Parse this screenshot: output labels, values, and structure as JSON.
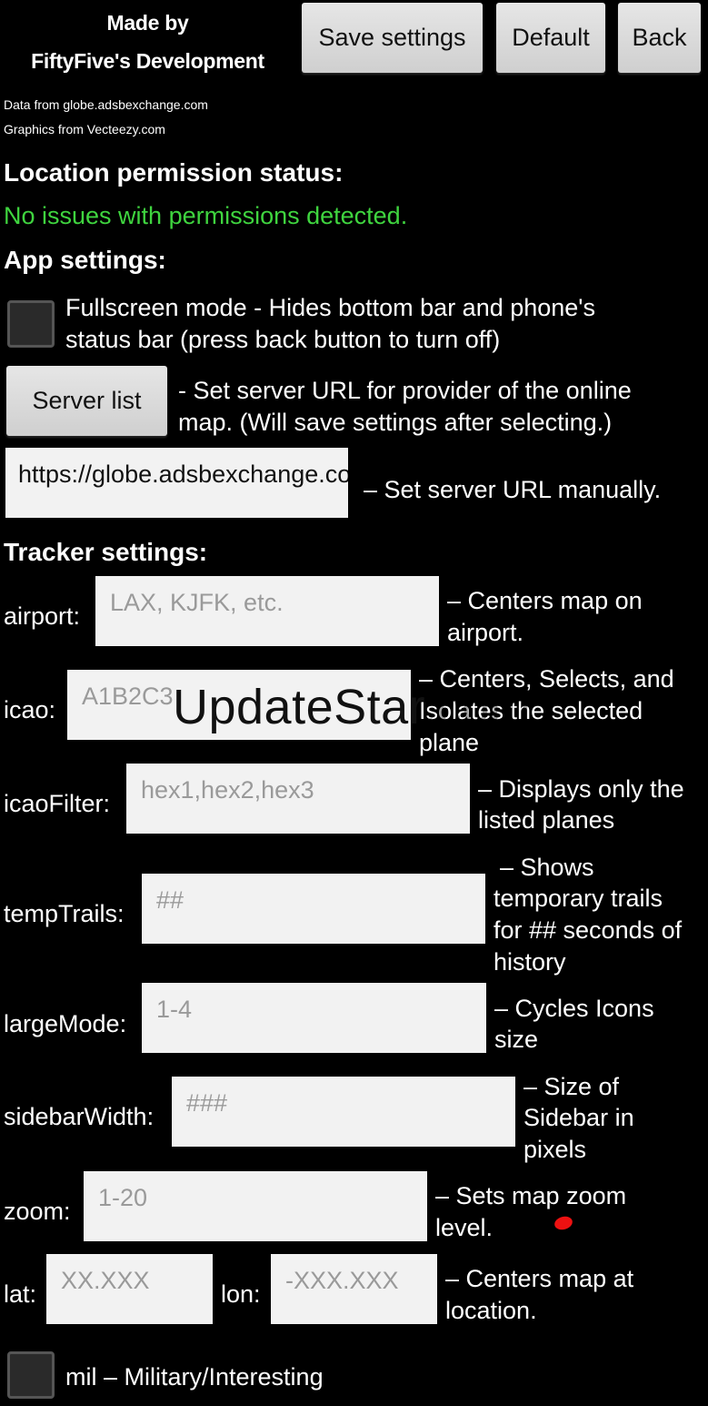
{
  "header": {
    "made_by_line1": "Made by",
    "made_by_line2": "FiftyFive's Development",
    "data_from": "Data from  globe.adsbexchange.com",
    "graphics_from": "Graphics from Vecteezy.com",
    "buttons": {
      "save": "Save settings",
      "default": "Default",
      "back": "Back"
    }
  },
  "location": {
    "heading": "Location permission status:",
    "status": "No issues with permissions detected.",
    "status_color": "#3fd43f"
  },
  "app_settings": {
    "heading": "App settings:",
    "fullscreen_label_line1": "Fullscreen mode - Hides bottom bar and phone's",
    "fullscreen_label_line2": "status bar (press back button to turn off)",
    "server_list_button": "Server list",
    "server_list_desc_line1": "- Set server URL for provider of the online",
    "server_list_desc_line2": "map. (Will save settings after selecting.)",
    "server_url_value": "https://globe.adsbexchange.com",
    "server_url_desc": "– Set server URL manually."
  },
  "tracker_settings": {
    "heading": "Tracker settings:",
    "airport": {
      "label": "airport:",
      "placeholder": "LAX, KJFK, etc.",
      "desc_line1": "– Centers map on",
      "desc_line2": "airport."
    },
    "icao": {
      "label": "icao:",
      "placeholder": "A1B2C3",
      "desc_line1": "– Centers, Selects, and",
      "desc_line2": "Isolates the selected",
      "desc_line3": "plane"
    },
    "icao_filter": {
      "label": "icaoFilter:",
      "placeholder": "hex1,hex2,hex3",
      "desc_line1": "– Displays only the",
      "desc_line2": "listed planes"
    },
    "temp_trails": {
      "label": "tempTrails:",
      "placeholder": "##",
      "desc_line1": "– Shows",
      "desc_line2": "temporary trails",
      "desc_line3": "for ## seconds of",
      "desc_line4": "history"
    },
    "large_mode": {
      "label": "largeMode:",
      "placeholder": "1-4",
      "desc_line1": "– Cycles Icons",
      "desc_line2": "size"
    },
    "sidebar_width": {
      "label": "sidebarWidth:",
      "placeholder": "###",
      "desc_line1": "– Size of",
      "desc_line2": "Sidebar in",
      "desc_line3": "pixels"
    },
    "zoom": {
      "label": "zoom:",
      "placeholder": "1-20",
      "desc_line1": "– Sets map zoom",
      "desc_line2": "level."
    },
    "lat": {
      "label": "lat:",
      "placeholder": "XX.XXX"
    },
    "lon": {
      "label": "lon:",
      "placeholder": "-XXX.XXX",
      "desc_line1": "– Centers map at",
      "desc_line2": "location."
    },
    "mil_label": "mil – Military/Interesting"
  },
  "watermark": {
    "main": "UpdateStar",
    "suffix": ".com"
  }
}
